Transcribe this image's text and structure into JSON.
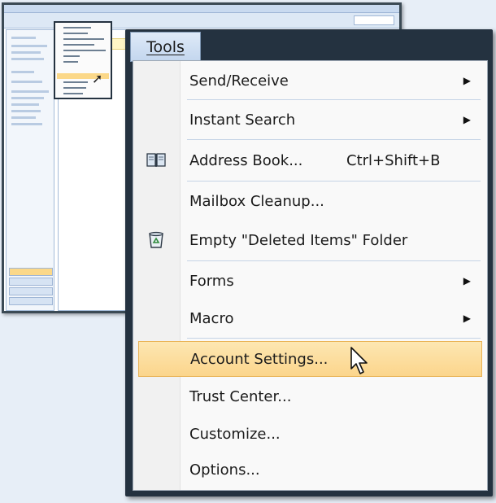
{
  "tools_tab": {
    "label": "Tools"
  },
  "menu_items": [
    {
      "label": "Send/Receive",
      "shortcut": "",
      "submenu": true,
      "icon": ""
    },
    {
      "label": "Instant Search",
      "shortcut": "",
      "submenu": true,
      "icon": ""
    },
    {
      "label": "Address Book...",
      "shortcut": "Ctrl+Shift+B",
      "submenu": false,
      "icon": "address-book-icon"
    },
    {
      "label": "Mailbox Cleanup...",
      "shortcut": "",
      "submenu": false,
      "icon": ""
    },
    {
      "label": "Empty \"Deleted Items\" Folder",
      "shortcut": "",
      "submenu": false,
      "icon": "recycle-bin-icon"
    },
    {
      "label": "Forms",
      "shortcut": "",
      "submenu": true,
      "icon": ""
    },
    {
      "label": "Macro",
      "shortcut": "",
      "submenu": true,
      "icon": ""
    },
    {
      "label": "Account Settings...",
      "shortcut": "",
      "submenu": false,
      "icon": "",
      "highlighted": true
    },
    {
      "label": "Trust Center...",
      "shortcut": "",
      "submenu": false,
      "icon": ""
    },
    {
      "label": "Customize...",
      "shortcut": "",
      "submenu": false,
      "icon": ""
    },
    {
      "label": "Options...",
      "shortcut": "",
      "submenu": false,
      "icon": ""
    }
  ],
  "submenu_arrow": "▶",
  "colors": {
    "frame": "#243240",
    "highlight": "#fbd58c",
    "separator": "#c5d4e6",
    "background": "#e7eef7"
  }
}
